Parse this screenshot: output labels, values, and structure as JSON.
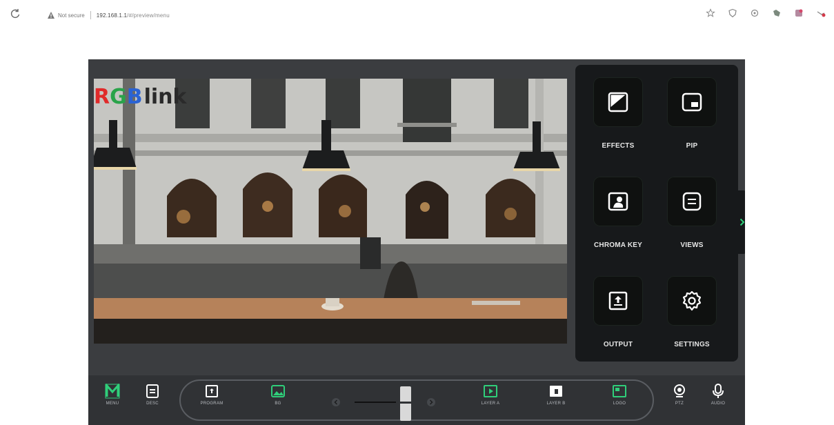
{
  "browser": {
    "not_secure": "Not secure",
    "url_host": "192.168.1.1",
    "url_path": "/#/preview/menu"
  },
  "panel": {
    "items": [
      {
        "label": "EFFECTS",
        "icon": "effects-icon"
      },
      {
        "label": "PIP",
        "icon": "pip-icon"
      },
      {
        "label": "CHROMA KEY",
        "icon": "chroma-key-icon"
      },
      {
        "label": "VIEWS",
        "icon": "views-icon"
      },
      {
        "label": "OUTPUT",
        "icon": "output-icon"
      },
      {
        "label": "SETTINGS",
        "icon": "settings-icon"
      }
    ]
  },
  "bottom": {
    "menu": "MENU",
    "desc": "DESC",
    "program": "PROGRAM",
    "bg": "BG",
    "layer_a": "LAYER A",
    "layer_b": "LAYER B",
    "logo": "LOGO",
    "ptz": "PTZ",
    "audio": "AUDIO"
  },
  "brand": {
    "logo_r": "R",
    "logo_g": "G",
    "logo_b": "B",
    "logo_word": "link"
  },
  "colors": {
    "accent": "#2fcf7a",
    "panel_bg": "#17191b",
    "app_bg": "#3b3d40"
  }
}
